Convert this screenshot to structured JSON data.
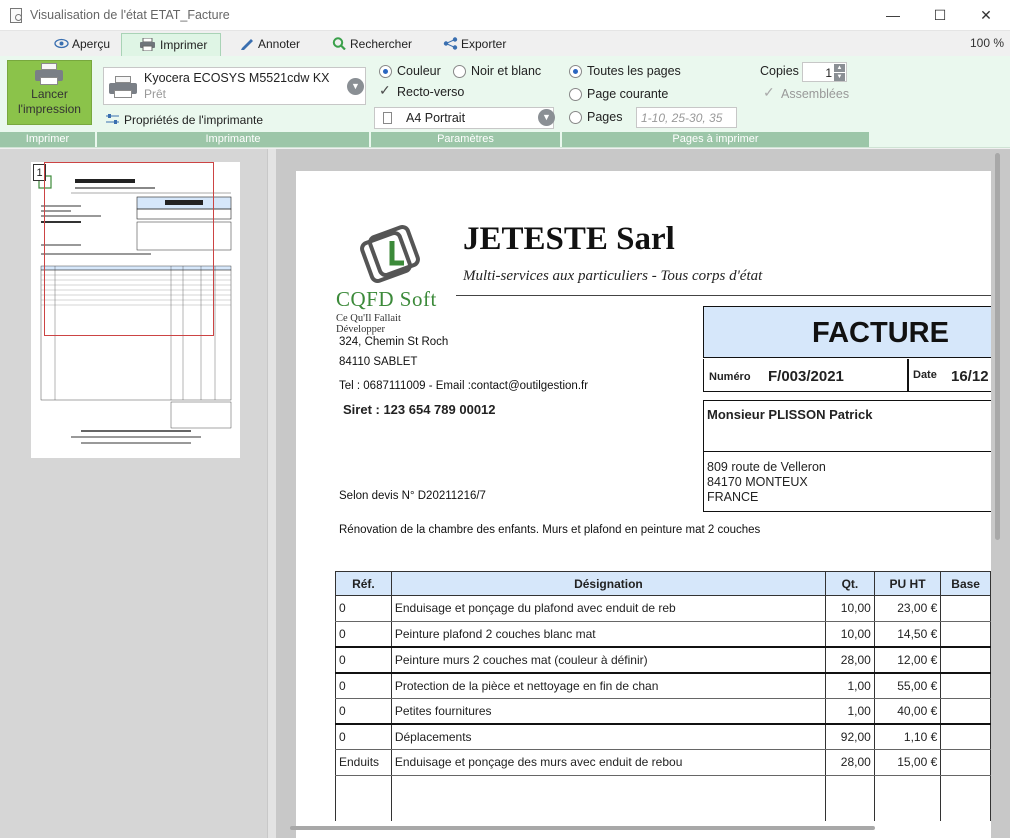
{
  "window": {
    "title": "Visualisation de l'état ETAT_Facture",
    "minimize": "—",
    "maximize": "☐",
    "close": "✕"
  },
  "tabs": [
    {
      "label": "Aperçu",
      "icon": "eye-icon"
    },
    {
      "label": "Imprimer",
      "icon": "printer-icon",
      "active": true
    },
    {
      "label": "Annoter",
      "icon": "pencil-icon"
    },
    {
      "label": "Rechercher",
      "icon": "magnifier-icon"
    },
    {
      "label": "Exporter",
      "icon": "share-icon"
    }
  ],
  "zoom": "100 %",
  "ribbon": {
    "print_button": "Lancer l'impression",
    "printer_name": "Kyocera ECOSYS M5521cdw KX",
    "printer_status": "Prêt",
    "printer_properties": "Propriétés de l'imprimante",
    "color": "Couleur",
    "bw": "Noir et blanc",
    "duplex": "Recto-verso",
    "paper": "A4 Portrait",
    "all_pages": "Toutes les pages",
    "current_page": "Page courante",
    "pages": "Pages",
    "pages_placeholder": "1-10, 25-30, 35",
    "copies_label": "Copies",
    "copies_value": "1",
    "collated": "Assemblées",
    "groups": {
      "print": "Imprimer",
      "printer": "Imprimante",
      "params": "Paramètres",
      "pages_to_print": "Pages à imprimer"
    }
  },
  "thumbnail": {
    "page_number": "1"
  },
  "document": {
    "logo_text": "CQFD Soft",
    "logo_tagline": "Ce Qu'Il Fallait Développer",
    "company": "JETESTE Sarl",
    "tagline": "Multi-services aux particuliers - Tous corps d'état",
    "address1": "324, Chemin St Roch",
    "address2": "84110 SABLET",
    "contact": "Tel : 0687111009 - Email :contact@outilgestion.fr",
    "siret": "Siret : 123 654 789 00012",
    "quote_ref": "Selon devis N° D20211216/7",
    "description": "Rénovation de la chambre des enfants. Murs et plafond en peinture mat 2 couches",
    "facture_title": "FACTURE",
    "numero_label": "Numéro",
    "numero_value": "F/003/2021",
    "date_label": "Date",
    "date_value": "16/12",
    "client_name": "Monsieur PLISSON Patrick",
    "client_addr1": "809 route de Velleron",
    "client_addr2": "84170 MONTEUX",
    "client_addr3": "FRANCE",
    "table_headers": [
      "Réf.",
      "Désignation",
      "Qt.",
      "PU HT",
      "Base"
    ],
    "rows": [
      {
        "ref": "0",
        "designation": "Enduisage et ponçage du plafond avec enduit de reb",
        "qty": "10,00",
        "pu": "23,00 €"
      },
      {
        "ref": "0",
        "designation": "Peinture plafond 2 couches blanc mat",
        "qty": "10,00",
        "pu": "14,50 €"
      },
      {
        "ref": "0",
        "designation": "Peinture murs 2 couches mat (couleur à définir)",
        "qty": "28,00",
        "pu": "12,00 €"
      },
      {
        "ref": "0",
        "designation": "Protection de la pièce et nettoyage en fin de chan",
        "qty": "1,00",
        "pu": "55,00 €"
      },
      {
        "ref": "0",
        "designation": "Petites fournitures",
        "qty": "1,00",
        "pu": "40,00 €"
      },
      {
        "ref": "0",
        "designation": "Déplacements",
        "qty": "92,00",
        "pu": "1,10 €"
      },
      {
        "ref": "Enduits",
        "designation": "Enduisage et ponçage des murs avec enduit de rebou",
        "qty": "28,00",
        "pu": "15,00 €"
      }
    ]
  }
}
